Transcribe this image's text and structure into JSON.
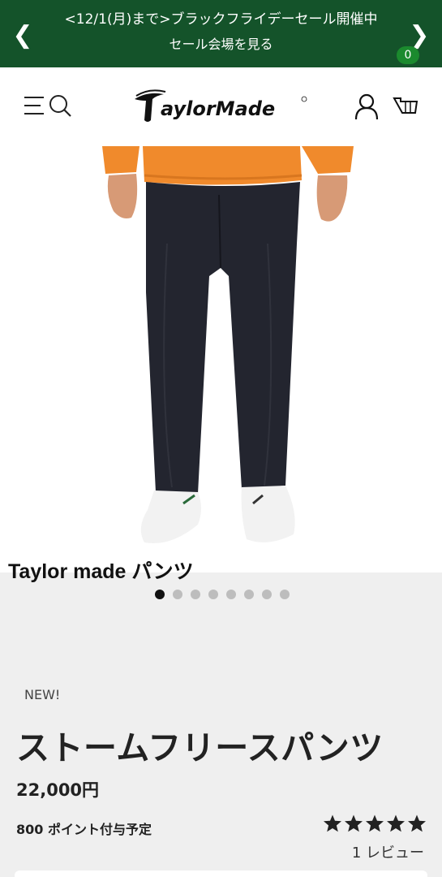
{
  "promo": {
    "line1": "<12/1(月)まで>ブラックフライデーセール開催中",
    "line2": "セール会場を見る",
    "prev_icon": "chevron-left-icon",
    "next_icon": "chevron-right-icon"
  },
  "header": {
    "logo_text": "TaylorMade",
    "menu_icon": "menu-icon",
    "search_icon": "search-icon",
    "account_icon": "account-icon",
    "cart_icon": "cart-icon",
    "cart_count": "0"
  },
  "gallery": {
    "caption": "Taylor made パンツ",
    "dot_count": 8,
    "active_index": 0
  },
  "product": {
    "badge": "NEW!",
    "title": "ストームフリースパンツ",
    "price": "22,000円",
    "points": "800 ポイント付与予定",
    "rating": 5,
    "rating_max": 5,
    "reviews": "1 レビュー"
  },
  "colors": {
    "banner": "#14532a",
    "cart_badge": "#1b8a2e"
  }
}
